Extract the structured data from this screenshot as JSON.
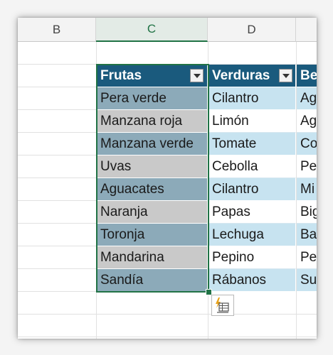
{
  "columns": [
    {
      "letter": "B"
    },
    {
      "letter": "C"
    },
    {
      "letter": "D"
    }
  ],
  "table": {
    "headers": [
      "Frutas",
      "Verduras",
      "Be"
    ],
    "frutas": [
      "Pera verde",
      "Manzana roja",
      "Manzana verde",
      "Uvas",
      "Aguacates",
      "Naranja",
      "Toronja",
      "Mandarina",
      "Sandía"
    ],
    "verduras": [
      "Cilantro",
      "Limón",
      "Tomate",
      "Cebolla",
      "Cilantro",
      "Papas",
      "Lechuga",
      "Pepino",
      "Rábanos"
    ],
    "bebidas_partial": [
      "Ag",
      "Ag",
      "Co",
      "Pe",
      "Mi",
      "Big",
      "Ba",
      "Pe",
      "Su"
    ]
  },
  "colors": {
    "selection": "#217346",
    "header_fill": "#1a5a7d",
    "frutas_band_dark": "#8caab9",
    "frutas_band_light": "#c9c9c9",
    "verduras_band": "#c7e3f0"
  },
  "icons": {
    "filter": "filter-dropdown-icon",
    "quick_analysis": "quick-analysis-icon"
  }
}
